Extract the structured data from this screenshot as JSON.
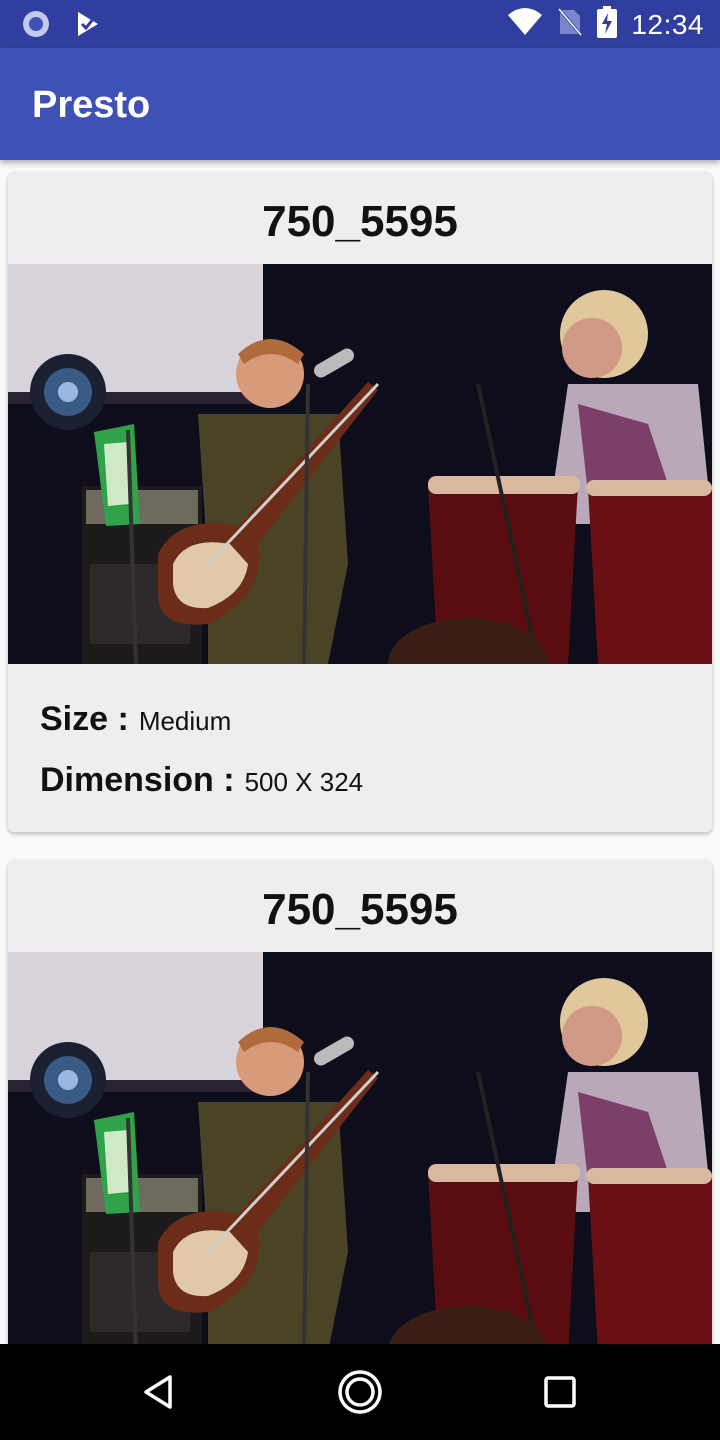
{
  "status_bar": {
    "time": "12:34",
    "icons": [
      "record-icon",
      "checkmark-icon",
      "wifi-icon",
      "no-sim-icon",
      "battery-charging-icon"
    ]
  },
  "app_bar": {
    "title": "Presto"
  },
  "cards": [
    {
      "title": "750_5595",
      "size_label": "Size :",
      "size_value": "Medium",
      "dimension_label": "Dimension :",
      "dimension_value": "500 X 324"
    },
    {
      "title": "750_5595"
    }
  ],
  "nav_bar": {
    "icons": [
      "back-icon",
      "home-icon",
      "recents-icon"
    ]
  },
  "colors": {
    "status_bar": "#303f9f",
    "app_bar": "#3f51b5",
    "card_bg": "#eeeeee",
    "nav_bar": "#000000"
  }
}
